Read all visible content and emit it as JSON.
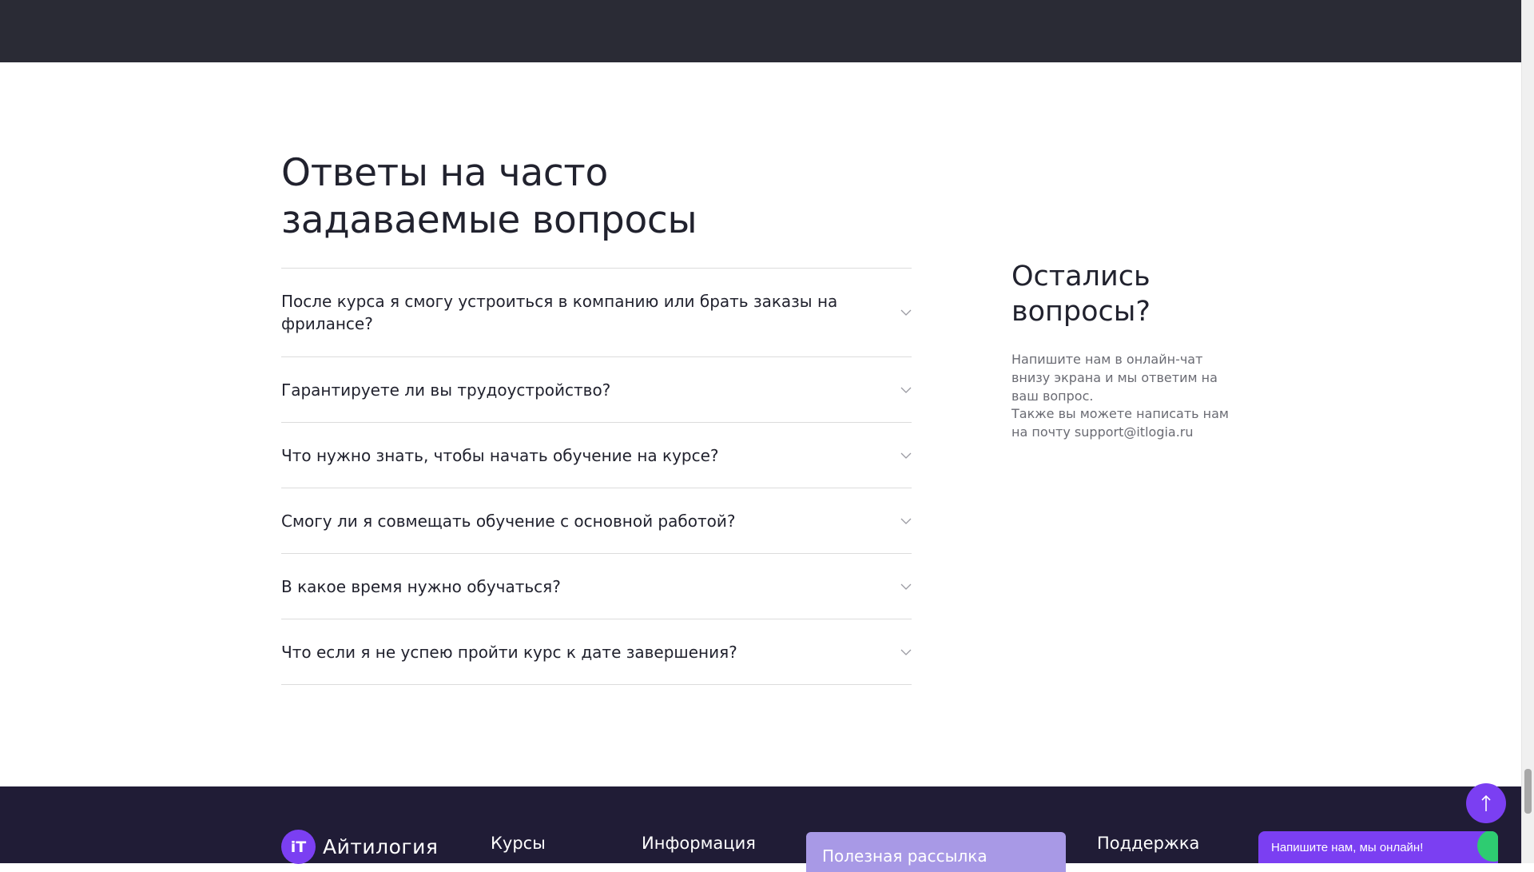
{
  "faq": {
    "title_line1": "Ответы на часто",
    "title_line2": "задаваемые вопросы",
    "items": [
      {
        "question": "После курса я смогу устроиться в компанию или брать заказы на фрилансе?"
      },
      {
        "question": "Гарантируете ли вы трудоустройство?"
      },
      {
        "question": "Что нужно знать, чтобы начать обучение на курсе?"
      },
      {
        "question": "Смогу ли я совмещать обучение с основной работой?"
      },
      {
        "question": "В какое время нужно обучаться?"
      },
      {
        "question": "Что если я не успею пройти курс к дате завершения?"
      }
    ],
    "chevron_icon": "chevron-down-icon"
  },
  "sidebar": {
    "title_line1": "Остались",
    "title_line2": "вопросы?",
    "text1": "Напишите нам в онлайн-чат внизу экрана и мы ответим на ваш вопрос.",
    "text2": "Также вы можете написать нам на почту support@itlogia.ru"
  },
  "footer": {
    "logo_mark": "iT",
    "logo_text": "Айтилогия",
    "col_courses": "Курсы",
    "col_info": "Информация",
    "newsletter": "Полезная рассылка",
    "col_support": "Поддержка"
  },
  "widgets": {
    "chat_label": "Напишите нам, мы онлайн!",
    "up_icon": "arrow-up-icon"
  },
  "colors": {
    "accent": "#7b3ff2",
    "footer_bg": "#201c36",
    "top_band": "#2a2b35",
    "online": "#2ecc71"
  }
}
